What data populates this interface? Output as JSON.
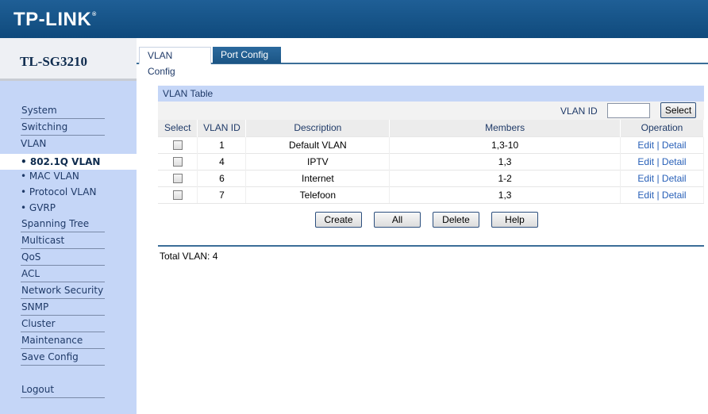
{
  "header": {
    "logo": "TP-LINK",
    "logo_mark": "®"
  },
  "device": {
    "model": "TL-SG3210"
  },
  "sidebar": {
    "items": [
      {
        "label": "System",
        "type": "main"
      },
      {
        "label": "Switching",
        "type": "main"
      },
      {
        "label": "VLAN",
        "type": "main"
      },
      {
        "label": "• 802.1Q VLAN",
        "type": "sub",
        "active": true
      },
      {
        "label": "• MAC VLAN",
        "type": "sub"
      },
      {
        "label": "• Protocol VLAN",
        "type": "sub"
      },
      {
        "label": "• GVRP",
        "type": "sub"
      },
      {
        "label": "Spanning Tree",
        "type": "main"
      },
      {
        "label": "Multicast",
        "type": "main"
      },
      {
        "label": "QoS",
        "type": "main"
      },
      {
        "label": "ACL",
        "type": "main"
      },
      {
        "label": "Network Security",
        "type": "main"
      },
      {
        "label": "SNMP",
        "type": "main"
      },
      {
        "label": "Cluster",
        "type": "main"
      },
      {
        "label": "Maintenance",
        "type": "main"
      },
      {
        "label": "Save Config",
        "type": "main"
      },
      {
        "label": "Logout",
        "type": "main"
      }
    ]
  },
  "tabs": [
    {
      "label": "VLAN Config",
      "active": true
    },
    {
      "label": "Port Config",
      "active": false
    }
  ],
  "vlan_table": {
    "title": "VLAN Table",
    "filter_label": "VLAN ID",
    "filter_value": "",
    "select_button": "Select",
    "columns": [
      "Select",
      "VLAN ID",
      "Description",
      "Members",
      "Operation"
    ],
    "rows": [
      {
        "vlan_id": "1",
        "description": "Default VLAN",
        "members": "1,3-10"
      },
      {
        "vlan_id": "4",
        "description": "IPTV",
        "members": "1,3"
      },
      {
        "vlan_id": "6",
        "description": "Internet",
        "members": "1-2"
      },
      {
        "vlan_id": "7",
        "description": "Telefoon",
        "members": "1,3"
      }
    ],
    "edit_label": "Edit",
    "op_separator": "|",
    "detail_label": "Detail"
  },
  "actions": {
    "create": "Create",
    "all": "All",
    "delete": "Delete",
    "help": "Help"
  },
  "footer": {
    "total": "Total VLAN: 4"
  },
  "colors": {
    "header_blue": "#1f5f96",
    "sidebar_bg": "#c5d6f7",
    "link": "#2860b8"
  }
}
